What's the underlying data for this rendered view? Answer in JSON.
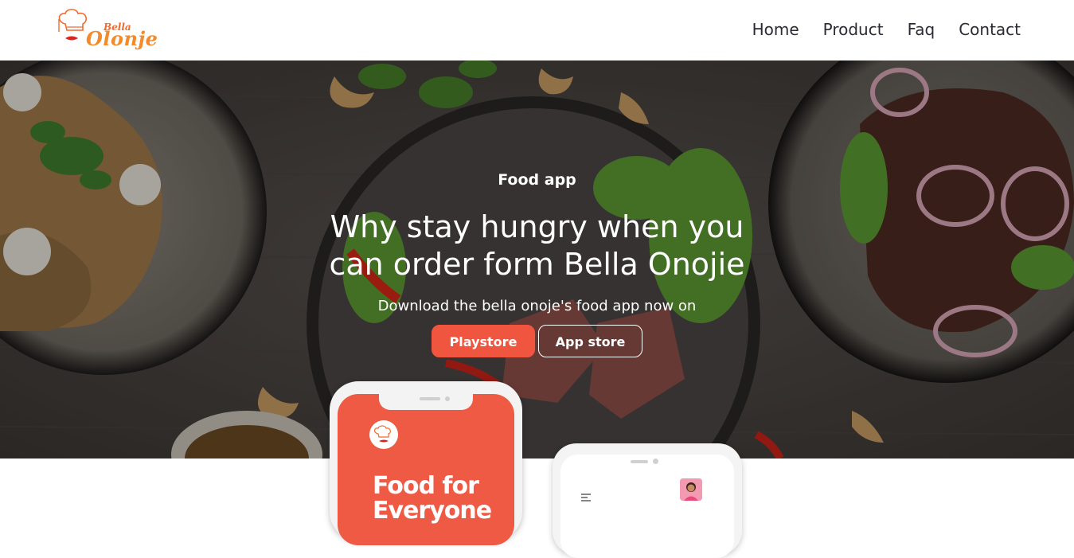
{
  "brand": {
    "logo_text_small": "Bella",
    "logo_text_large": "Olonje",
    "accent_color": "#f0553f",
    "logo_color": "#f58a2a"
  },
  "nav": {
    "items": [
      {
        "label": "Home"
      },
      {
        "label": "Product"
      },
      {
        "label": "Faq"
      },
      {
        "label": "Contact"
      }
    ]
  },
  "hero": {
    "eyebrow": "Food app",
    "headline_line1": "Why stay hungry when you",
    "headline_line2": "can order form Bella Onojie",
    "subline": "Download the bella onoje's food app now on",
    "playstore_label": "Playstore",
    "appstore_label": "App store"
  },
  "phone_mockup": {
    "title_line1": "Food for",
    "title_line2": "Everyone",
    "screen_color": "#ef5a44"
  },
  "icons": [
    "chef-hat-icon",
    "menu-icon",
    "avatar"
  ]
}
